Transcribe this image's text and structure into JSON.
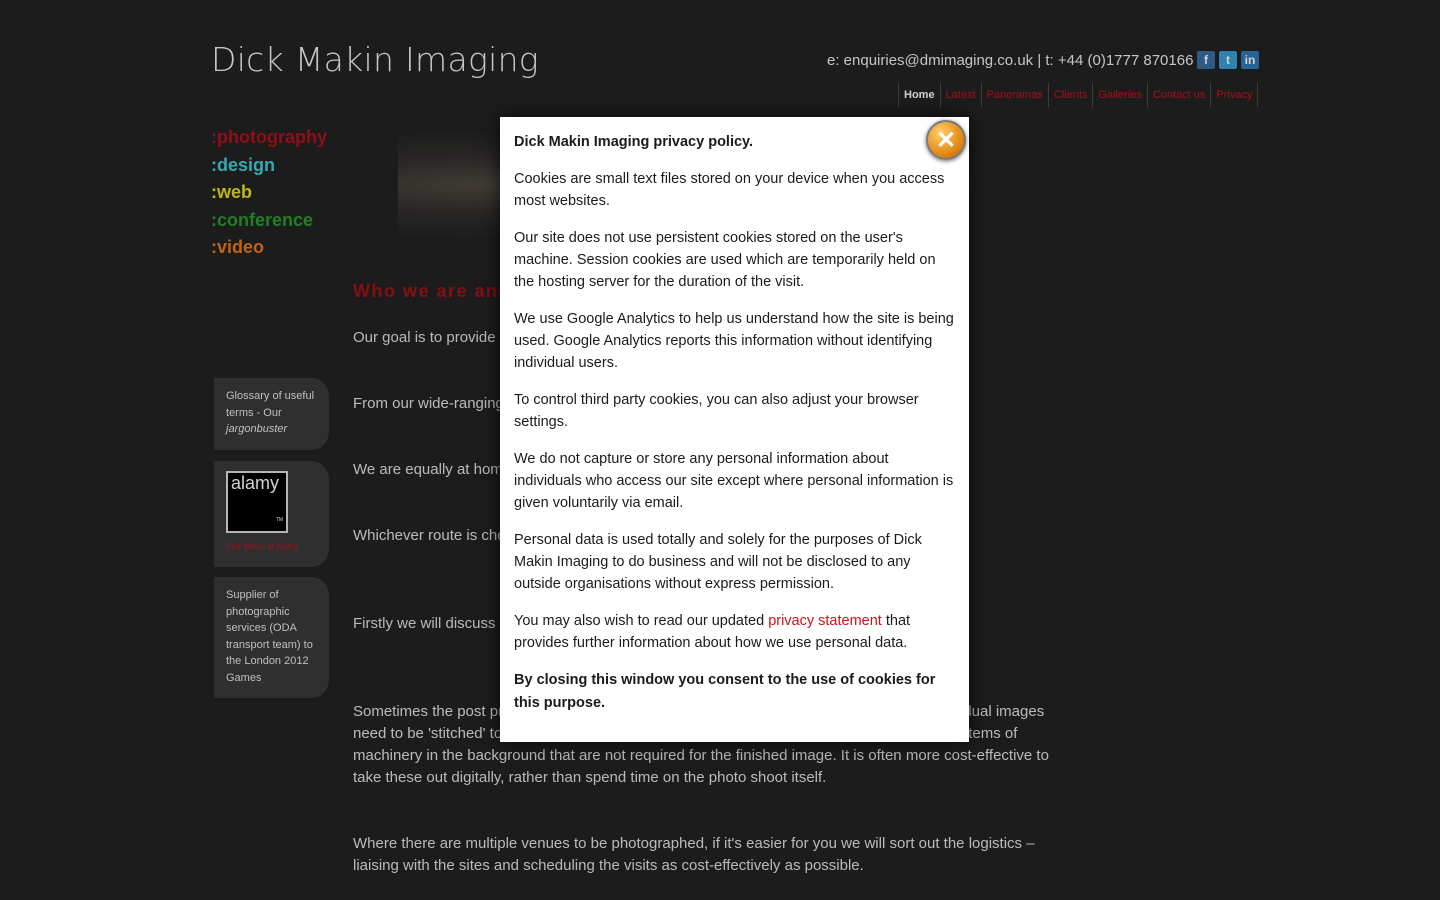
{
  "header": {
    "title": "Dick Makin Imaging",
    "contact": "e: enquiries@dmimaging.co.uk | t: +44 (0)1777 870166",
    "social": [
      {
        "icon": "facebook-icon",
        "glyph": "f"
      },
      {
        "icon": "twitter-icon",
        "glyph": "t"
      },
      {
        "icon": "linkedin-icon",
        "glyph": "in"
      }
    ]
  },
  "nav": [
    "Home",
    "Latest",
    "Panoramas",
    "Clients",
    "Galleries",
    "Contact us",
    "Privacy"
  ],
  "categories": [
    {
      "label": ":photography",
      "color": "#b0121a"
    },
    {
      "label": ":design",
      "color": "#3fd0d8"
    },
    {
      "label": ":web",
      "color": "#e8e020"
    },
    {
      "label": ":conference",
      "color": "#2a9a2a"
    },
    {
      "label": ":video",
      "color": "#e87a1e"
    }
  ],
  "main": {
    "heading": "Who we are and",
    "paragraphs": [
      "Our goal is to provide h                                                                                                                   et. As every photographic proj",
      "From our wide-ranging                                                                                                                      ctive solution in terms of the",
      "We are equally at home                                                                                                                     iative and experience to provide c",
      "Whichever route is chos                                                                                                                    ut the nature of the product, se                                                                                                           for you. It all helps us to 'get unde",
      "Firstly we will discuss th                                                                                                                   he photography is likely to                                                                                                                . reference prints, DVD).",
      "Sometimes the post pr                                                                                                                      e colour balance. At other times                                                                                                          mage is to be a panorama, the individual images need to be 'stitched' together to make the whole. Or when working in a factory there may be items of machinery in the background that are not required for the finished image. It is often more cost-effective to take these out digitally, rather than spend time on the photo shoot itself.",
      "Where there are multiple venues to be photographed, if it's easier for you we will sort out the logistics – liaising with the sites and scheduling the visits as cost-effectively as possible."
    ]
  },
  "sidebar": {
    "glossary": {
      "text": "Glossary of useful terms - Our ",
      "italic": "jargonbuster"
    },
    "alamy": {
      "logo": "alamy",
      "tm": "TM",
      "link": "Dick Makin at Alamy"
    },
    "supplier": "Supplier of photographic services (ODA transport team) to the London 2012 Games"
  },
  "modal": {
    "title": "Dick Makin Imaging privacy policy.",
    "paragraphs": [
      "Cookies are small text files stored on your device when you access most websites.",
      "Our site does not use persistent cookies stored on the user's machine. Session cookies are used which are temporarily held on the hosting server for the duration of the visit.",
      "We use Google Analytics to help us understand how the site is being used. Google Analytics reports this information without identifying individual users.",
      "To control third party cookies, you can also adjust your browser settings.",
      "We do not capture or store any personal information about individuals who access our site except where personal information is given voluntarily via email.",
      "Personal data is used totally and solely for the purposes of Dick Makin Imaging to do business and will not be disclosed to any outside organisations without express permission."
    ],
    "statement_pre": "You may also wish to read our updated ",
    "statement_link": "privacy statement",
    "statement_post": " that provides further information about how we use personal data.",
    "consent": "By closing this window you consent to the use of cookies for this purpose.",
    "close_glyph": "✕"
  }
}
